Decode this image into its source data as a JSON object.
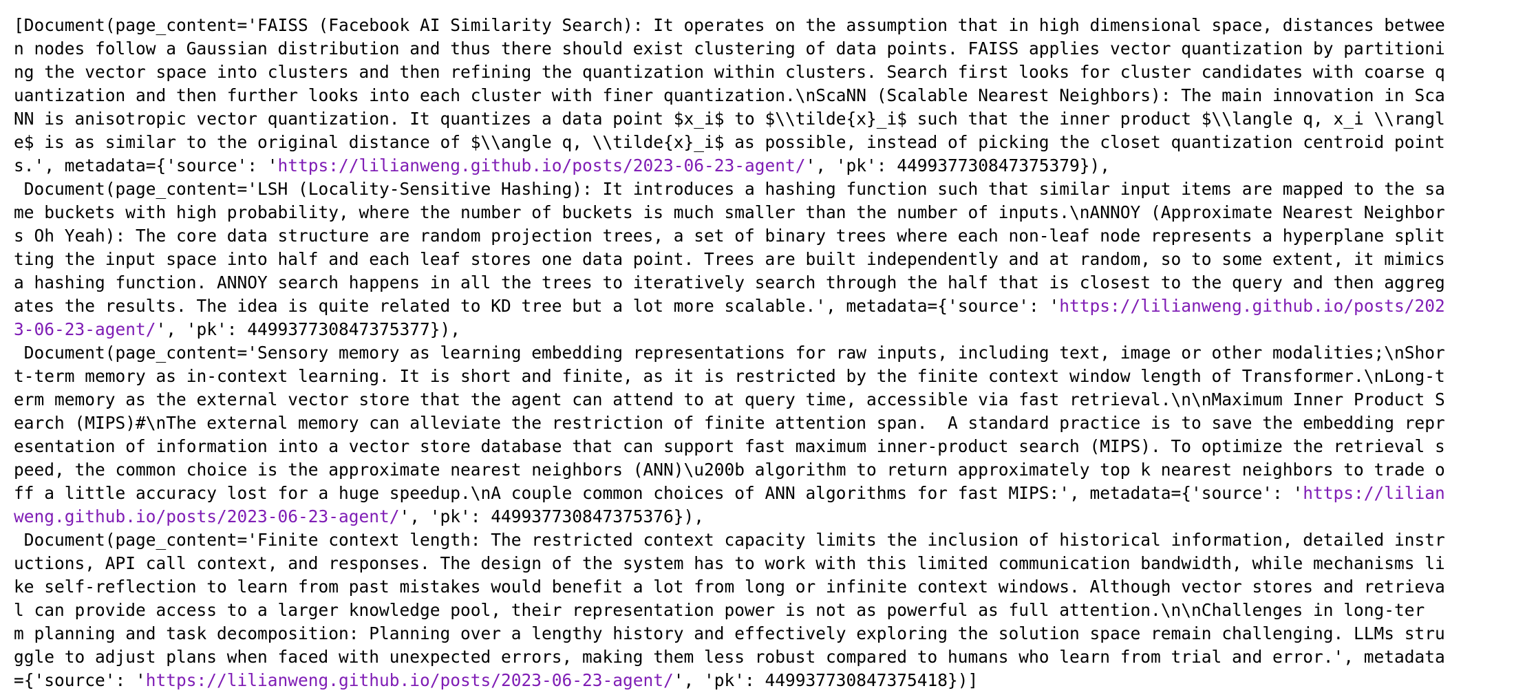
{
  "output": {
    "link_color": "#7f1db5",
    "lines": [
      [
        "[Document(page_content='FAISS (Facebook AI Similarity Search): It operates on the assumption that in high dimensional space, distances betwee"
      ],
      [
        "n nodes follow a Gaussian distribution and thus there should exist clustering of data points. FAISS applies vector quantization by partitioni"
      ],
      [
        "ng the vector space into clusters and then refining the quantization within clusters. Search first looks for cluster candidates with coarse q"
      ],
      [
        "uantization and then further looks into each cluster with finer quantization.\\nScaNN (Scalable Nearest Neighbors): The main innovation in Sca"
      ],
      [
        "NN is anisotropic vector quantization. It quantizes a data point $x_i$ to $\\\\tilde{x}_i$ such that the inner product $\\\\langle q, x_i \\\\rangl"
      ],
      [
        "e$ is as similar to the original distance of $\\\\angle q, \\\\tilde{x}_i$ as possible, instead of picking the closet quantization centroid point"
      ],
      [
        "s.', metadata={'source': '",
        "https://lilianweng.github.io/posts/2023-06-23-agent/",
        "', 'pk': 449937730847375379}),"
      ],
      [
        " Document(page_content='LSH (Locality-Sensitive Hashing): It introduces a hashing function such that similar input items are mapped to the sa"
      ],
      [
        "me buckets with high probability, where the number of buckets is much smaller than the number of inputs.\\nANNOY (Approximate Nearest Neighbor"
      ],
      [
        "s Oh Yeah): The core data structure are random projection trees, a set of binary trees where each non-leaf node represents a hyperplane split"
      ],
      [
        "ting the input space into half and each leaf stores one data point. Trees are built independently and at random, so to some extent, it mimics"
      ],
      [
        "a hashing function. ANNOY search happens in all the trees to iteratively search through the half that is closest to the query and then aggreg"
      ],
      [
        "ates the results. The idea is quite related to KD tree but a lot more scalable.', metadata={'source': '",
        "https://lilianweng.github.io/posts/202",
        ""
      ],
      [
        "",
        "3-06-23-agent/",
        "', 'pk': 449937730847375377}),"
      ],
      [
        " Document(page_content='Sensory memory as learning embedding representations for raw inputs, including text, image or other modalities;\\nShor"
      ],
      [
        "t-term memory as in-context learning. It is short and finite, as it is restricted by the finite context window length of Transformer.\\nLong-t"
      ],
      [
        "erm memory as the external vector store that the agent can attend to at query time, accessible via fast retrieval.\\n\\nMaximum Inner Product S"
      ],
      [
        "earch (MIPS)#\\nThe external memory can alleviate the restriction of finite attention span.  A standard practice is to save the embedding repr"
      ],
      [
        "esentation of information into a vector store database that can support fast maximum inner-product search (MIPS). To optimize the retrieval s"
      ],
      [
        "peed, the common choice is the approximate nearest neighbors (ANN)\\u200b algorithm to return approximately top k nearest neighbors to trade o"
      ],
      [
        "ff a little accuracy lost for a huge speedup.\\nA couple common choices of ANN algorithms for fast MIPS:', metadata={'source': '",
        "https://lilian",
        ""
      ],
      [
        "",
        "weng.github.io/posts/2023-06-23-agent/",
        "', 'pk': 449937730847375376}),"
      ],
      [
        " Document(page_content='Finite context length: The restricted context capacity limits the inclusion of historical information, detailed instr"
      ],
      [
        "uctions, API call context, and responses. The design of the system has to work with this limited communication bandwidth, while mechanisms li"
      ],
      [
        "ke self-reflection to learn from past mistakes would benefit a lot from long or infinite context windows. Although vector stores and retrieva"
      ],
      [
        "l can provide access to a larger knowledge pool, their representation power is not as powerful as full attention.\\n\\nChallenges in long-ter"
      ],
      [
        "m planning and task decomposition: Planning over a lengthy history and effectively exploring the solution space remain challenging. LLMs stru"
      ],
      [
        "ggle to adjust plans when faced with unexpected errors, making them less robust compared to humans who learn from trial and error.', metadata"
      ],
      [
        "={'source': '",
        "https://lilianweng.github.io/posts/2023-06-23-agent/",
        "', 'pk': 449937730847375418})]"
      ]
    ]
  }
}
